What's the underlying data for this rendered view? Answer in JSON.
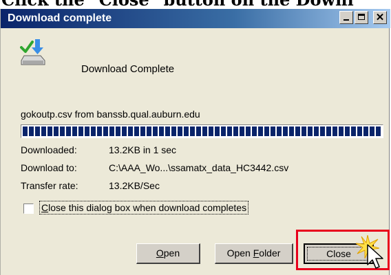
{
  "document": {
    "caption": "Click the \"Close\" button on the Downl"
  },
  "dialog": {
    "title": "Download complete",
    "heading": "Download Complete",
    "source": "gokoutp.csv from banssb.qual.auburn.edu",
    "progress": {
      "fraction": 1.0
    },
    "details": [
      {
        "label": "Downloaded:",
        "value": "13.2KB in 1 sec"
      },
      {
        "label": "Download to:",
        "value": "C:\\AAA_Wo...\\ssamatx_data_HC3442.csv"
      },
      {
        "label": "Transfer rate:",
        "value": "13.2KB/Sec"
      }
    ],
    "auto_close": {
      "checked": false,
      "label_prefix": "",
      "label_key": "C",
      "label_rest": "lose this dialog box when download completes"
    },
    "buttons": {
      "open": {
        "key": "O",
        "rest": "pen"
      },
      "open_folder": {
        "prefix": "Open ",
        "key": "F",
        "rest": "older"
      },
      "close": "Close"
    }
  },
  "colors": {
    "title_bar": "#0a246a",
    "progress": "#0a246a",
    "highlight": "#e8001c",
    "dialog_bg": "#ece9d8"
  },
  "icons": [
    "download-complete-icon",
    "minimize-icon",
    "maximize-icon",
    "close-icon",
    "click-burst-icon",
    "mouse-cursor-icon"
  ]
}
